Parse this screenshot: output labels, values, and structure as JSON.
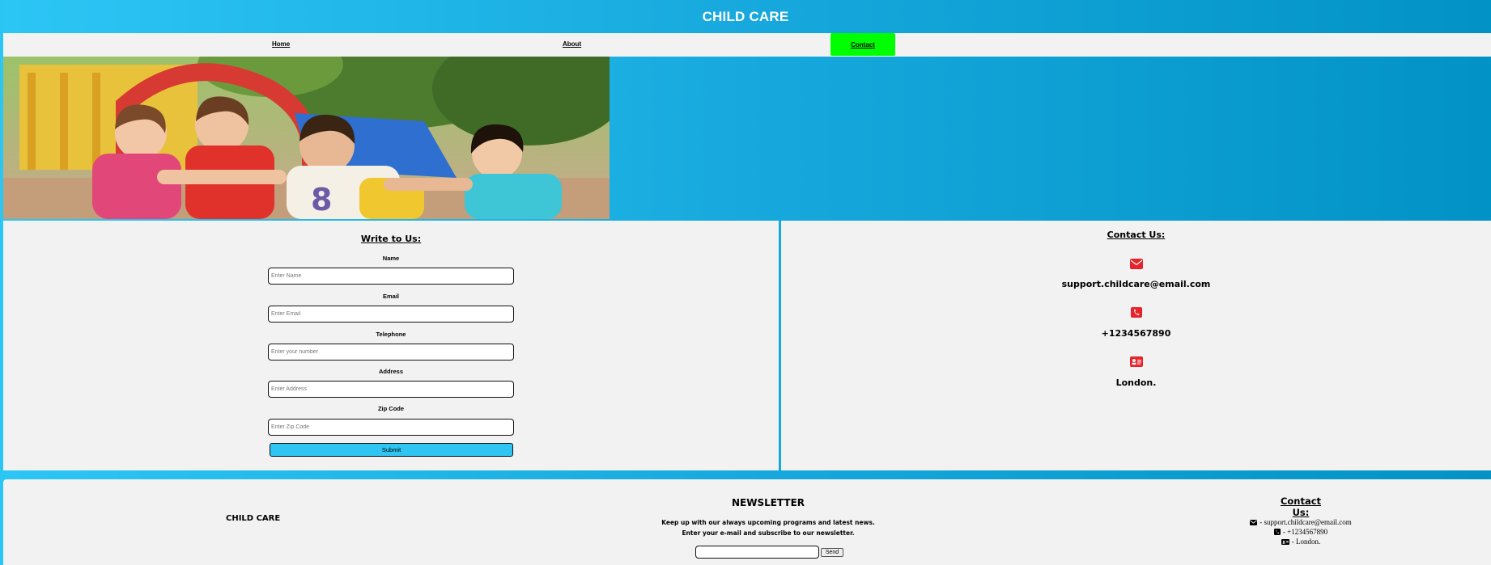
{
  "header": {
    "title": "CHILD CARE"
  },
  "nav": {
    "items": [
      {
        "label": "Home"
      },
      {
        "label": "About"
      },
      {
        "label": "Contact"
      }
    ],
    "active_color": "#00ff00"
  },
  "hero": {
    "image": "children-playground-photo"
  },
  "write_form": {
    "title": "Write to Us:",
    "fields": [
      {
        "label": "Name",
        "placeholder": "Enter Name"
      },
      {
        "label": "Email",
        "placeholder": "Enter Email"
      },
      {
        "label": "Telephone",
        "placeholder": "Enter your number"
      },
      {
        "label": "Address",
        "placeholder": "Enter Address"
      },
      {
        "label": "Zip Code",
        "placeholder": "Enter Zip Code"
      }
    ],
    "submit_label": "Submit",
    "submit_color": "#2ec5f3"
  },
  "contact_panel": {
    "title": "Contact Us:",
    "email": "support.childcare@email.com",
    "phone": "+1234567890",
    "address": "London.",
    "icon_color": "#e8232a",
    "icons": [
      "envelope-icon",
      "phone-icon",
      "address-card-icon"
    ]
  },
  "footer": {
    "brand": "CHILD CARE",
    "newsletter": {
      "title": "NEWSLETTER",
      "line1": "Keep up with our always upcoming programs and latest news.",
      "line2": "Enter your e-mail and subscribe to our newsletter.",
      "send_label": "Send"
    },
    "contact": {
      "title": "Contact Us:",
      "email_line": "- support.childcare@email.com",
      "phone_line": "- +1234567890",
      "address_line": "- London."
    }
  }
}
